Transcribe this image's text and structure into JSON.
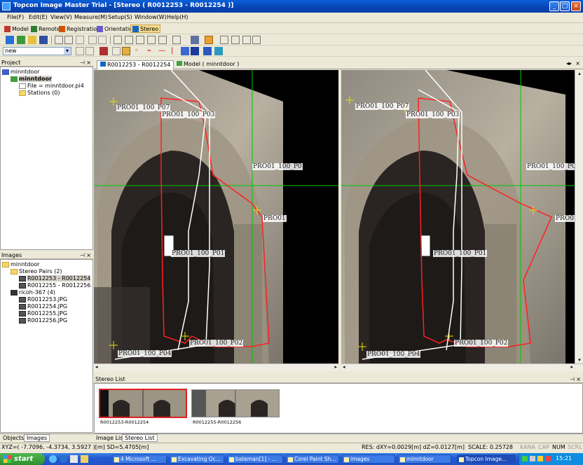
{
  "window": {
    "title": "Topcon Image Master Trial - [Stereo ( R0012253 - R0012254 )]"
  },
  "menu": [
    "File(F)",
    "Edit(E)",
    "View(V)",
    "Measure(M)",
    "Setup(S)",
    "Window(W)",
    "Help(H)"
  ],
  "modes": [
    {
      "label": "Model",
      "color": "#c0392b"
    },
    {
      "label": "Remote",
      "color": "#2e7d32"
    },
    {
      "label": "Registration",
      "color": "#d35400"
    },
    {
      "label": "Orientation",
      "color": "#6a5acd"
    },
    {
      "label": "Stereo",
      "color": "#1565c0"
    }
  ],
  "layer_select": {
    "value": "new"
  },
  "project_panel": {
    "title": "Project",
    "items": [
      "minntdoor",
      "minntdoor",
      "File = minntdoor.pi4",
      "Stations (0)"
    ]
  },
  "images_panel": {
    "title": "Images",
    "items": [
      "minntdoor",
      "Stereo Pairs (2)",
      "R0012253 - R0012254",
      "R0012255 - R0012256",
      "ricoh-367 (4)",
      "R0012253.JPG",
      "R0012254.JPG",
      "R0012255.JPG",
      "R0012256.JPG"
    ]
  },
  "left_tabs": [
    "Objects",
    "Images"
  ],
  "doc_tabs": [
    "R0012253 - R0012254",
    "Model ( minntdoor )"
  ],
  "point_labels": {
    "p07": "PRO01_100_P07",
    "p03": "PRO01_100_P03",
    "p00": "PRO01_100_P0",
    "p0": "PRO01",
    "p01": "PRO01_100_P01",
    "p02": "PRO01_100_P02",
    "p04": "PRO01_100_P04"
  },
  "stereo_list": {
    "title": "Stereo List",
    "thumbs": [
      "R0012253-R0012254",
      "R0012255-R0012256"
    ]
  },
  "bottom_tabs": [
    "Image List",
    "Stereo List"
  ],
  "status": {
    "coords": "XYZ=( -7.7096, -4.3734, 3.5927 )[m] SD=5.4705[m]",
    "res": "RES: dXY=0.0029[m] dZ=0.0127[m]",
    "scale": "SCALE: 0.25728",
    "indicators": [
      "KANA",
      "CAP",
      "NUM",
      "SCRL"
    ]
  },
  "taskbar": {
    "start": "start",
    "tasks": [
      "4 Microsoft ...",
      "Excavating Oc...",
      "bateman[1] - ...",
      "Corel Paint Sh...",
      "images",
      "minntdoor",
      "Topcon Image..."
    ],
    "clock": "15:21"
  },
  "colors": {
    "crosshair": "#00c800",
    "outline": "#ff2020",
    "line": "#ffffff",
    "marker": "#f0e000"
  }
}
